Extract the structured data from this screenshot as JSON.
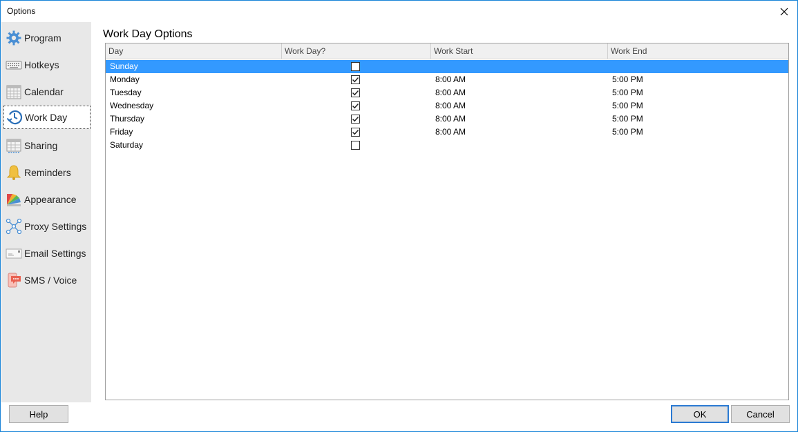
{
  "window": {
    "title": "Options"
  },
  "sidebar": {
    "items": [
      {
        "label": "Program",
        "icon": "gear-icon",
        "selected": false
      },
      {
        "label": "Hotkeys",
        "icon": "keyboard-icon",
        "selected": false
      },
      {
        "label": "Calendar",
        "icon": "calendar-icon",
        "selected": false
      },
      {
        "label": "Work Day",
        "icon": "clock-icon",
        "selected": true
      },
      {
        "label": "Sharing",
        "icon": "sharing-icon",
        "selected": false
      },
      {
        "label": "Reminders",
        "icon": "bell-icon",
        "selected": false
      },
      {
        "label": "Appearance",
        "icon": "palette-icon",
        "selected": false
      },
      {
        "label": "Proxy Settings",
        "icon": "network-icon",
        "selected": false
      },
      {
        "label": "Email Settings",
        "icon": "envelope-icon",
        "selected": false
      },
      {
        "label": "SMS / Voice",
        "icon": "sms-icon",
        "selected": false
      }
    ]
  },
  "content": {
    "title": "Work Day Options",
    "columns": [
      "Day",
      "Work Day?",
      "Work Start",
      "Work End"
    ],
    "rows": [
      {
        "day": "Sunday",
        "work_day": false,
        "start": "",
        "end": "",
        "selected": true
      },
      {
        "day": "Monday",
        "work_day": true,
        "start": "8:00 AM",
        "end": "5:00 PM",
        "selected": false
      },
      {
        "day": "Tuesday",
        "work_day": true,
        "start": "8:00 AM",
        "end": "5:00 PM",
        "selected": false
      },
      {
        "day": "Wednesday",
        "work_day": true,
        "start": "8:00 AM",
        "end": "5:00 PM",
        "selected": false
      },
      {
        "day": "Thursday",
        "work_day": true,
        "start": "8:00 AM",
        "end": "5:00 PM",
        "selected": false
      },
      {
        "day": "Friday",
        "work_day": true,
        "start": "8:00 AM",
        "end": "5:00 PM",
        "selected": false
      },
      {
        "day": "Saturday",
        "work_day": false,
        "start": "",
        "end": "",
        "selected": false
      }
    ]
  },
  "buttons": {
    "help": "Help",
    "ok": "OK",
    "cancel": "Cancel"
  },
  "colors": {
    "selection": "#3399ff",
    "accent": "#1883d7",
    "sidebar_bg": "#e8e8e8"
  }
}
